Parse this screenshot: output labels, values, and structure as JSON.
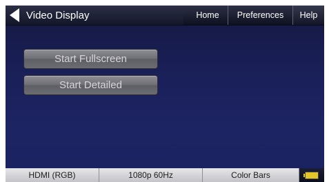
{
  "header": {
    "title": "Video Display",
    "back_icon": "back-arrow-icon",
    "tabs": [
      {
        "label": "Home"
      },
      {
        "label": "Preferences"
      },
      {
        "label": "Help"
      }
    ]
  },
  "main": {
    "buttons": [
      {
        "label": "Start Fullscreen"
      },
      {
        "label": "Start Detailed"
      }
    ]
  },
  "status": {
    "interface": "HDMI (RGB)",
    "format": "1080p 60Hz",
    "pattern": "Color Bars",
    "battery_icon": "battery-icon",
    "battery_color": "#e3c627"
  },
  "colors": {
    "background": "#1c2463",
    "button": "#6e6e75",
    "status_bar": "#d5d5da"
  }
}
